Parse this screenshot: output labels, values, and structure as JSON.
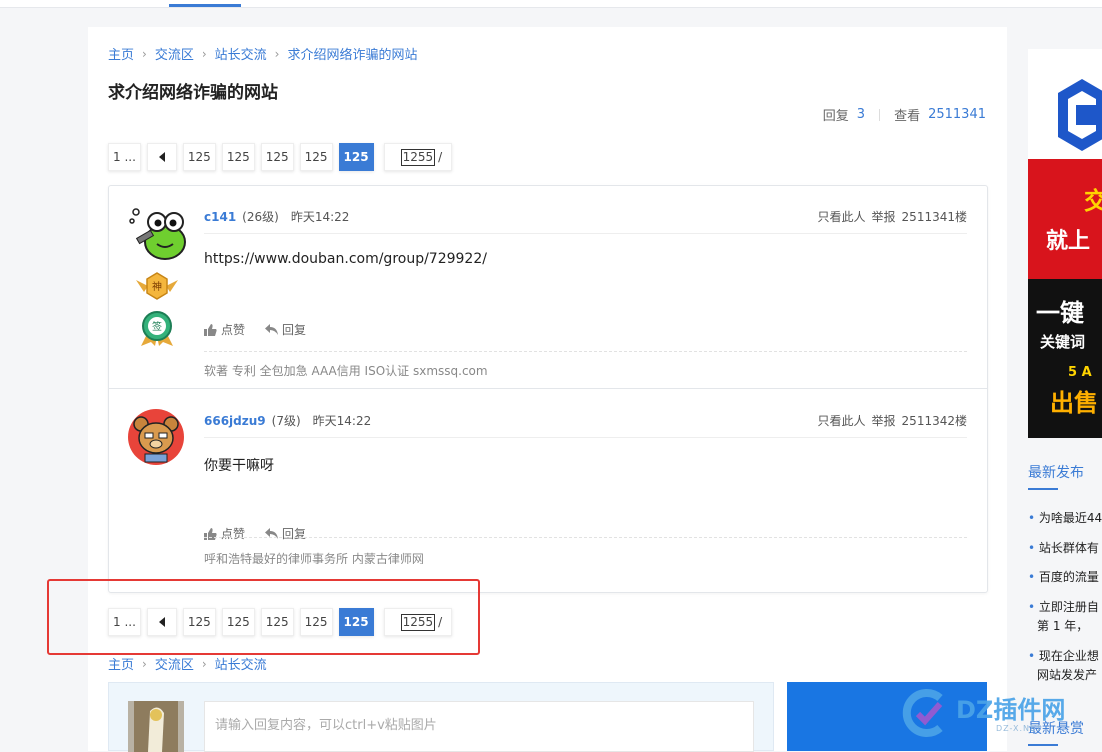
{
  "breadcrumb": {
    "items": [
      "主页",
      "交流区",
      "站长交流",
      "求介绍网络诈骗的网站"
    ],
    "separator": "›"
  },
  "thread": {
    "title": "求介绍网络诈骗的网站",
    "reply_label": "回复",
    "reply_count": "3",
    "view_label": "查看",
    "view_count": "2511341"
  },
  "pager": {
    "first": "1 ...",
    "pages": [
      "125",
      "125",
      "125",
      "125"
    ],
    "current": "125",
    "jump_value": "1255",
    "jump_suffix": "/"
  },
  "posts": [
    {
      "username": "c141",
      "level": "(26级)",
      "time": "昨天14:22",
      "only_view": "只看此人",
      "report": "举报",
      "floor": "2511341楼",
      "content": "https://www.douban.com/group/729922/",
      "like_label": "点赞",
      "reply_label": "回复",
      "signature": "软著 专利 全包加急 AAA信用 ISO认证 sxmssq.com",
      "badge1": "神",
      "badge2": "签"
    },
    {
      "username": "666jdzu9",
      "level": "(7级)",
      "time": "昨天14:22",
      "only_view": "只看此人",
      "report": "举报",
      "floor": "2511342楼",
      "content": "你要干嘛呀",
      "like_label": "点赞",
      "reply_label": "回复",
      "signature": "呼和浩特最好的律师事务所 内蒙古律师网"
    }
  ],
  "bottom_breadcrumb": [
    "主页",
    "交流区",
    "站长交流"
  ],
  "reply_box": {
    "placeholder": "请输入回复内容，可以ctrl+v粘贴图片"
  },
  "sidebar": {
    "banner_lines": [
      "交",
      "就上",
      "一键",
      "关键词",
      "5 A",
      "出售"
    ],
    "latest_title": "最新发布",
    "latest_items": [
      "为啥最近44",
      "站长群体有",
      "百度的流量",
      "立即注册自",
      "第 1 年，",
      "现在企业想",
      "网站发发产"
    ],
    "reward_title": "最新悬赏"
  },
  "watermark": {
    "text": "DZ插件网",
    "sub": "DZ-X.NET"
  },
  "colors": {
    "accent": "#3a7bd5",
    "highlight_box": "#e53935",
    "banner_red": "#c8161d"
  }
}
